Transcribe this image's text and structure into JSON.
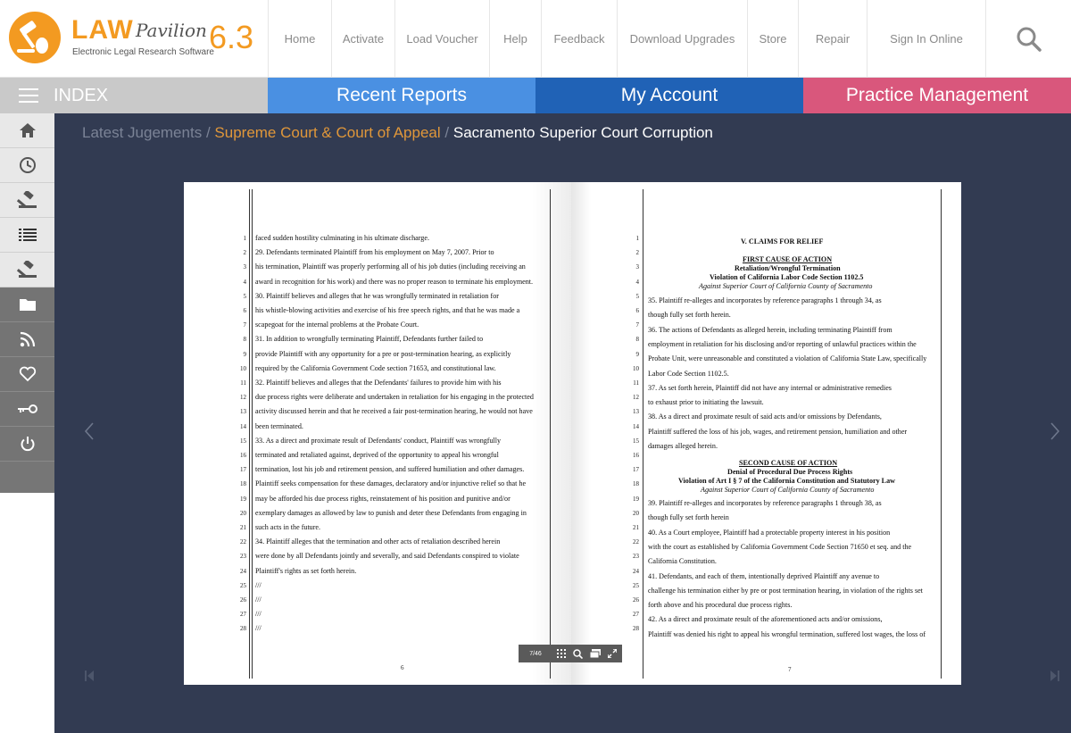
{
  "logo": {
    "brand": "LAW",
    "brand_script": "Pavilion",
    "version": "6.3",
    "tagline": "Electronic Legal Research Software"
  },
  "nav": [
    {
      "label": "Home"
    },
    {
      "label": "Activate"
    },
    {
      "label": "Load Voucher"
    },
    {
      "label": "Help"
    },
    {
      "label": "Feedback"
    },
    {
      "label": "Download Upgrades"
    },
    {
      "label": "Store"
    },
    {
      "label": "Repair"
    },
    {
      "label": "Sign In Online"
    }
  ],
  "bar2": {
    "index_label": "INDEX",
    "tabs": [
      {
        "label": "Recent Reports"
      },
      {
        "label": "My Account"
      },
      {
        "label": "Practice Management"
      }
    ]
  },
  "sidebar": {
    "icons": [
      "home-icon",
      "clock-icon",
      "gavel-icon",
      "list-icon",
      "gavel-icon",
      "folder-icon",
      "rss-icon",
      "heart-icon",
      "key-icon",
      "power-icon"
    ]
  },
  "breadcrumb": {
    "part1": "Latest Jugements",
    "part2": "Supreme Court & Court of Appeal",
    "part3": "Sacramento Superior Court Corruption",
    "sep": "/"
  },
  "viewer": {
    "page_indicator": "7/46",
    "left_page_number": "6",
    "right_page_number": "7"
  },
  "left_page": {
    "lines": [
      "faced sudden hostility culminating in his ultimate discharge.",
      "        29.     Defendants terminated Plaintiff from his employment on May 7, 2007.  Prior to",
      "his termination, Plaintiff was properly performing all of his job duties (including receiving an",
      "award in recognition for his work) and there was no proper reason to terminate his employment.",
      "        30.     Plaintiff believes and alleges that he was wrongfully terminated in retaliation for",
      "his whistle-blowing activities and exercise of his free speech rights, and that he was made a",
      "scapegoat for the internal problems at the Probate Court.",
      "        31.     In addition to wrongfully terminating Plaintiff, Defendants further failed to",
      "provide Plaintiff with any opportunity for a pre or post-termination hearing, as explicitly",
      "required by the California Government Code section 71653, and constitutional law.",
      "        32.     Plaintiff believes and alleges that the Defendants' failures to provide him with his",
      "due process rights were deliberate and undertaken in retaliation for his engaging in the protected",
      "activity discussed herein and that he received a fair post-termination hearing, he would not have",
      "been terminated.",
      "        33.     As a direct and proximate result of Defendants' conduct, Plaintiff was wrongfully",
      "terminated and retaliated against, deprived of the opportunity to appeal his wrongful",
      "termination, lost his job and retirement pension, and suffered humiliation and other damages.",
      "Plaintiff seeks compensation for these damages, declaratory and/or injunctive relief so that he",
      "may be afforded his due process rights, reinstatement of his position and punitive and/or",
      "exemplary damages as allowed by law to punish and deter these Defendants from engaging in",
      "such acts in the future.",
      "        34.     Plaintiff alleges that the termination and other acts of retaliation described herein",
      "were done by all Defendants jointly and severally, and said Defendants conspired to violate",
      "Plaintiff's rights as set forth herein.",
      "///",
      "///",
      "///",
      "///"
    ]
  },
  "right_page": {
    "heading": "V. CLAIMS FOR RELIEF",
    "first_cause": "FIRST CAUSE OF ACTION",
    "first_sub1": "Retaliation/Wrongful Termination",
    "first_sub2": "Violation of California Labor Code Section 1102.5",
    "first_sub3": "Against Superior Court of California County of Sacramento",
    "first_lines": [
      "        35.     Plaintiff re-alleges and incorporates by reference paragraphs 1 through 34, as",
      "though fully set forth herein.",
      "        36.     The actions of Defendants as alleged herein, including terminating Plaintiff from",
      "employment in retaliation for his disclosing and/or reporting of unlawful practices within the",
      "Probate Unit, were unreasonable and constituted a violation of California State Law, specifically",
      "Labor Code Section 1102.5.",
      "        37.     As set forth herein, Plaintiff did not have any internal or administrative remedies",
      "to exhaust prior to initiating the lawsuit.",
      "        38.     As a direct and proximate result of said acts and/or omissions by Defendants,",
      "Plaintiff suffered the loss of his job, wages, and retirement pension, humiliation and other",
      "damages alleged herein."
    ],
    "second_cause": "SECOND CAUSE OF ACTION",
    "second_sub1": "Denial of Procedural Due Process Rights",
    "second_sub2": "Violation of Art I § 7 of the California Constitution and Statutory Law",
    "second_sub3": "Against Superior Court of California County of Sacramento",
    "second_lines": [
      "        39.     Plaintiff re-alleges and incorporates by reference paragraphs 1 through 38, as",
      "though fully set forth herein",
      "        40.     As a Court employee, Plaintiff had a protectable property interest in his position",
      "with the court as established by California Government Code Section 71650 et seq. and the",
      "California Constitution.",
      "        41.     Defendants, and each of them, intentionally deprived Plaintiff any avenue to",
      "challenge his termination either by pre or post termination hearing, in violation of the rights set",
      "forth above and his procedural due process rights.",
      "        42.     As a direct and proximate result of the aforementioned acts and/or omissions,",
      "Plaintiff was denied his right to appeal his wrongful termination, suffered lost wages, the loss of"
    ]
  }
}
